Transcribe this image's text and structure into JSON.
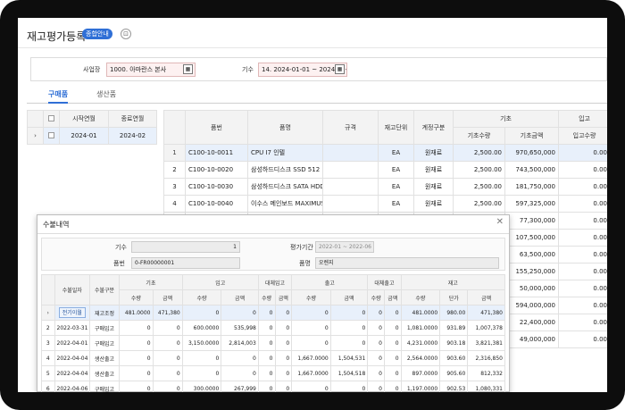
{
  "header": {
    "title": "재고평가등록",
    "badge": "종합안내",
    "icon": "help-icon"
  },
  "filter": {
    "site_label": "사업장",
    "site_value": "1000. 아마란스 본사",
    "period_label": "기수",
    "period_value": "14. 2024-01-01 ~ 2024-12-"
  },
  "tabs": [
    {
      "label": "구매품",
      "active": true
    },
    {
      "label": "생산품",
      "active": false
    }
  ],
  "left_grid": {
    "headers": [
      "시작연월",
      "종료연월"
    ],
    "rows": [
      {
        "start": "2024-01",
        "end": "2024-02"
      }
    ]
  },
  "main_grid": {
    "headers": [
      "품번",
      "품명",
      "규격",
      "재고단위",
      "계정구분"
    ],
    "group_header": "기초",
    "group_header2": "입고",
    "sub_headers": [
      "기초수량",
      "기초금액",
      "입고수량"
    ],
    "rows": [
      {
        "no": "1",
        "code": "C100-10-0011",
        "name": "CPU I7 인텔",
        "spec": "",
        "unit": "EA",
        "acct": "원재료",
        "qty": "2,500.00",
        "amt": "970,650,000",
        "in_qty": "0.00"
      },
      {
        "no": "2",
        "code": "C100-10-0020",
        "name": "삼성하드디스크 SSD 512",
        "spec": "",
        "unit": "EA",
        "acct": "원재료",
        "qty": "2,500.00",
        "amt": "743,500,000",
        "in_qty": "0.00"
      },
      {
        "no": "3",
        "code": "C100-10-0030",
        "name": "삼성하드디스크 SATA HDD",
        "spec": "",
        "unit": "EA",
        "acct": "원재료",
        "qty": "2,500.00",
        "amt": "181,750,000",
        "in_qty": "0.00"
      },
      {
        "no": "4",
        "code": "C100-10-0040",
        "name": "이수스 메인보드 MAXIMUS V",
        "spec": "",
        "unit": "EA",
        "acct": "원재료",
        "qty": "2,500.00",
        "amt": "597,325,000",
        "in_qty": "0.00"
      },
      {
        "no": "",
        "code": "",
        "name": "",
        "spec": "",
        "unit": "",
        "acct": "",
        "qty": "",
        "amt": "77,300,000",
        "in_qty": "0.00"
      },
      {
        "no": "",
        "code": "",
        "name": "",
        "spec": "",
        "unit": "",
        "acct": "",
        "qty": "",
        "amt": "107,500,000",
        "in_qty": "0.00"
      },
      {
        "no": "",
        "code": "",
        "name": "",
        "spec": "",
        "unit": "",
        "acct": "",
        "qty": "",
        "amt": "63,500,000",
        "in_qty": "0.00"
      },
      {
        "no": "",
        "code": "",
        "name": "",
        "spec": "",
        "unit": "",
        "acct": "",
        "qty": "",
        "amt": "155,250,000",
        "in_qty": "0.00"
      },
      {
        "no": "",
        "code": "",
        "name": "",
        "spec": "",
        "unit": "",
        "acct": "",
        "qty": "",
        "amt": "50,000,000",
        "in_qty": "0.00"
      },
      {
        "no": "",
        "code": "",
        "name": "",
        "spec": "",
        "unit": "",
        "acct": "",
        "qty": "",
        "amt": "594,000,000",
        "in_qty": "0.00"
      },
      {
        "no": "",
        "code": "",
        "name": "",
        "spec": "",
        "unit": "",
        "acct": "",
        "qty": "",
        "amt": "22,400,000",
        "in_qty": "0.00"
      },
      {
        "no": "",
        "code": "",
        "name": "",
        "spec": "",
        "unit": "",
        "acct": "",
        "qty": "",
        "amt": "49,000,000",
        "in_qty": "0.00"
      }
    ]
  },
  "popup": {
    "title": "수불내역",
    "close": "✕",
    "period_label": "기수",
    "period_value": "1",
    "eval_label": "평가기간",
    "eval_value": "2022-01 ~ 2022-06",
    "code_label": "품번",
    "code_value": "0-FR00000001",
    "name_label": "품명",
    "name_value": "오렌지",
    "col_groups": [
      "기초",
      "입고",
      "대체입고",
      "출고",
      "대체출고",
      "재고"
    ],
    "cols": [
      "수불일자",
      "수불구분",
      "수량",
      "금액",
      "수량",
      "금액",
      "수량",
      "금액",
      "수량",
      "금액",
      "수량",
      "금액",
      "수량",
      "단가",
      "금액"
    ],
    "rows": [
      {
        "no": "",
        "date": "전기이월",
        "type": "재고조정",
        "v": [
          "481.0000",
          "471,380",
          "0",
          "0",
          "0",
          "0",
          "0",
          "0",
          "0",
          "0",
          "481.0000",
          "980.00",
          "471,380"
        ]
      },
      {
        "no": "2",
        "date": "2022-03-31",
        "type": "구매입고",
        "v": [
          "0",
          "0",
          "600.0000",
          "535,998",
          "0",
          "0",
          "0",
          "0",
          "0",
          "0",
          "1,081.0000",
          "931.89",
          "1,007,378"
        ]
      },
      {
        "no": "3",
        "date": "2022-04-01",
        "type": "구매입고",
        "v": [
          "0",
          "0",
          "3,150.0000",
          "2,814,003",
          "0",
          "0",
          "0",
          "0",
          "0",
          "0",
          "4,231.0000",
          "903.18",
          "3,821,381"
        ]
      },
      {
        "no": "4",
        "date": "2022-04-04",
        "type": "생산출고",
        "v": [
          "0",
          "0",
          "0",
          "0",
          "0",
          "0",
          "1,667.0000",
          "1,504,531",
          "0",
          "0",
          "2,564.0000",
          "903.60",
          "2,316,850"
        ]
      },
      {
        "no": "5",
        "date": "2022-04-04",
        "type": "생산출고",
        "v": [
          "0",
          "0",
          "0",
          "0",
          "0",
          "0",
          "1,667.0000",
          "1,504,518",
          "0",
          "0",
          "897.0000",
          "905.60",
          "812,332"
        ]
      },
      {
        "no": "6",
        "date": "2022-04-06",
        "type": "구매입고",
        "v": [
          "0",
          "0",
          "300.0000",
          "267,999",
          "0",
          "0",
          "0",
          "0",
          "0",
          "0",
          "1,197.0000",
          "902.53",
          "1,080,331"
        ]
      }
    ]
  }
}
